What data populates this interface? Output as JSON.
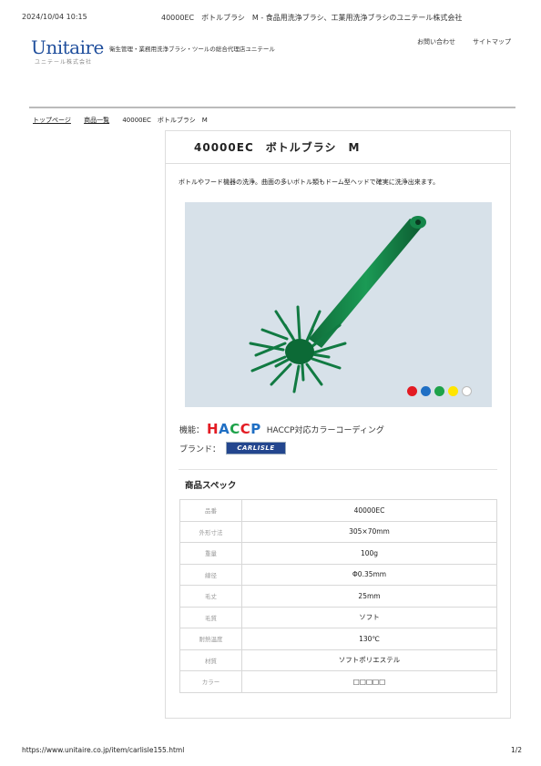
{
  "print_header": {
    "timestamp": "2024/10/04 10:15",
    "title": "40000EC　ボトルブラシ　M - 食品用洗浄ブラシ、工業用洗浄ブラシのユニテール株式会社"
  },
  "site": {
    "logo": "Unitaire",
    "logo_sub": "ユニテール株式会社",
    "tagline": "衛生管理・業務用洗浄ブラシ・ツールの総合代理店ユニテール",
    "nav": [
      "お問い合わせ",
      "サイトマップ"
    ]
  },
  "breadcrumb": [
    "トップページ",
    "商品一覧",
    "40000EC　ボトルブラシ　M"
  ],
  "product": {
    "title": "40000EC　ボトルブラシ　M",
    "description": "ボトルやフード機器の洗浄。曲面の多いボトル類もドーム型ヘッドで確実に洗浄出来ます。",
    "color_dots": [
      "#e31b23",
      "#1f6fc4",
      "#1ea24a",
      "#ffe500",
      "#ffffff"
    ],
    "feature_label": "機能：",
    "haccp_logo": "HACCP",
    "feature_text": "HACCP対応カラーコーディング",
    "brand_label": "ブランド：",
    "brand_logo": "CARLISLE"
  },
  "spec": {
    "heading": "商品スペック",
    "rows": [
      {
        "label": "品番",
        "value": "40000EC"
      },
      {
        "label": "外形寸法",
        "value": "305×70mm"
      },
      {
        "label": "重量",
        "value": "100g"
      },
      {
        "label": "線径",
        "value": "Φ0.35mm"
      },
      {
        "label": "毛丈",
        "value": "25mm"
      },
      {
        "label": "毛質",
        "value": "ソフト"
      },
      {
        "label": "耐熱温度",
        "value": "130℃"
      },
      {
        "label": "材質",
        "value": "ソフトポリエステル"
      },
      {
        "label": "カラー",
        "value": "□□□□□"
      }
    ]
  },
  "print_footer": {
    "url": "https://www.unitaire.co.jp/item/carlisle155.html",
    "page": "1/2"
  }
}
